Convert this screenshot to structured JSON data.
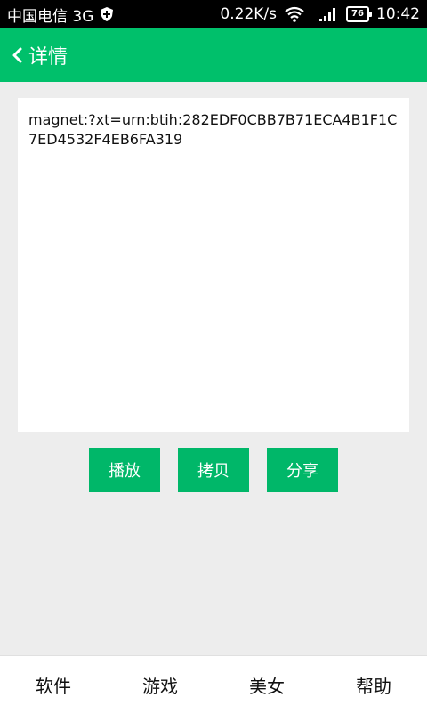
{
  "status_bar": {
    "carrier": "中国电信 3G",
    "speed": "0.22K/s",
    "battery": "76",
    "time": "10:42",
    "icons": [
      "shield-plus-icon",
      "wifi-icon",
      "signal-icon",
      "battery-icon"
    ]
  },
  "header": {
    "title": "详情",
    "back_icon": "chevron-left-icon"
  },
  "detail": {
    "magnet_link": "magnet:?xt=urn:btih:282EDF0CBB7B71ECA4B1F1C7ED4532F4EB6FA319"
  },
  "actions": {
    "play": "播放",
    "copy": "拷贝",
    "share": "分享"
  },
  "bottom_nav": {
    "items": [
      "软件",
      "游戏",
      "美女",
      "帮助"
    ]
  },
  "colors": {
    "accent": "#00c06b",
    "button": "#00b769",
    "background": "#ededed"
  }
}
